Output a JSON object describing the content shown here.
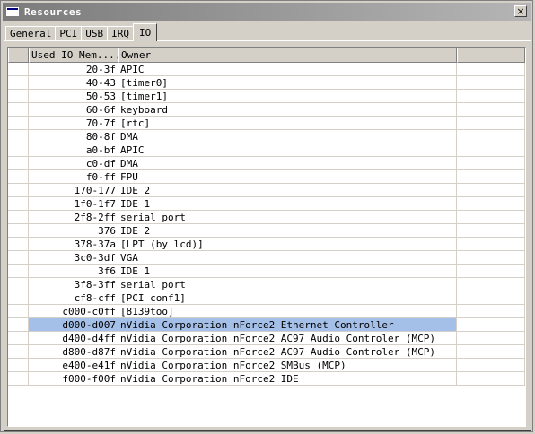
{
  "window": {
    "title": "Resources",
    "close_glyph": "×"
  },
  "tabs": [
    {
      "label": "General"
    },
    {
      "label": "PCI"
    },
    {
      "label": "USB"
    },
    {
      "label": "IRQ"
    },
    {
      "label": "IO",
      "active": true
    }
  ],
  "table": {
    "columns": [
      {
        "label": ""
      },
      {
        "label": "Used IO Mem...",
        "sort": "ascending"
      },
      {
        "label": "Owner"
      },
      {
        "label": ""
      }
    ],
    "selected_row": 19,
    "rows": [
      {
        "range": "20-3f",
        "owner": "APIC"
      },
      {
        "range": "40-43",
        "owner": "[timer0]"
      },
      {
        "range": "50-53",
        "owner": "[timer1]"
      },
      {
        "range": "60-6f",
        "owner": "keyboard"
      },
      {
        "range": "70-7f",
        "owner": "[rtc]"
      },
      {
        "range": "80-8f",
        "owner": "DMA"
      },
      {
        "range": "a0-bf",
        "owner": "APIC"
      },
      {
        "range": "c0-df",
        "owner": "DMA"
      },
      {
        "range": "f0-ff",
        "owner": "FPU"
      },
      {
        "range": "170-177",
        "owner": "IDE 2"
      },
      {
        "range": "1f0-1f7",
        "owner": "IDE 1"
      },
      {
        "range": "2f8-2ff",
        "owner": "serial port"
      },
      {
        "range": "376",
        "owner": "IDE 2"
      },
      {
        "range": "378-37a",
        "owner": "[LPT (by lcd)]"
      },
      {
        "range": "3c0-3df",
        "owner": "VGA"
      },
      {
        "range": "3f6",
        "owner": "IDE 1"
      },
      {
        "range": "3f8-3ff",
        "owner": "serial port"
      },
      {
        "range": "cf8-cff",
        "owner": "[PCI conf1]"
      },
      {
        "range": "c000-c0ff",
        "owner": "[8139too]"
      },
      {
        "range": "d000-d007",
        "owner": "nVidia Corporation nForce2 Ethernet Controller"
      },
      {
        "range": "d400-d4ff",
        "owner": "nVidia Corporation nForce2 AC97 Audio Controler (MCP)"
      },
      {
        "range": "d800-d87f",
        "owner": "nVidia Corporation nForce2 AC97 Audio Controler (MCP)"
      },
      {
        "range": "e400-e41f",
        "owner": "nVidia Corporation nForce2 SMBus (MCP)"
      },
      {
        "range": "f000-f00f",
        "owner": "nVidia Corporation nForce2 IDE"
      }
    ]
  },
  "colors": {
    "selection": "#a4c0e8",
    "titlebar_start": "#7b7b7b",
    "titlebar_end": "#b5b5b5",
    "face": "#d4d0c8"
  }
}
